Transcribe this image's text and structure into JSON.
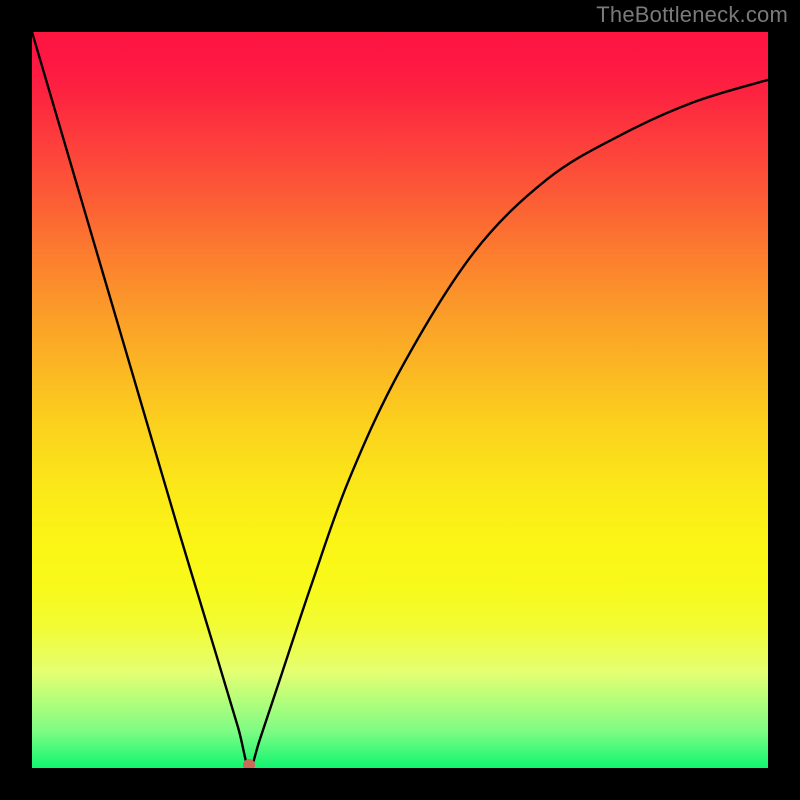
{
  "watermark": "TheBottleneck.com",
  "chart_data": {
    "type": "line",
    "title": "",
    "xlabel": "",
    "ylabel": "",
    "xlim": [
      0,
      1
    ],
    "ylim": [
      0,
      1
    ],
    "note": "Single V-shaped bottleneck curve with a minimum near x≈0.295, y≈0 (marked by a small red dot). Left branch is steep and nearly linear; right branch rises with decreasing slope. Values are normalized fractions of the plot area since no numeric axes are shown.",
    "series": [
      {
        "name": "bottleneck-curve",
        "x": [
          0.0,
          0.05,
          0.1,
          0.15,
          0.2,
          0.25,
          0.28,
          0.295,
          0.31,
          0.34,
          0.38,
          0.43,
          0.5,
          0.6,
          0.7,
          0.8,
          0.9,
          1.0
        ],
        "y": [
          1.0,
          0.83,
          0.66,
          0.49,
          0.32,
          0.155,
          0.055,
          0.0,
          0.04,
          0.13,
          0.25,
          0.39,
          0.54,
          0.7,
          0.8,
          0.86,
          0.905,
          0.935
        ]
      }
    ],
    "marker": {
      "x": 0.295,
      "y": 0.0,
      "color": "#c96b56"
    },
    "background_gradient": {
      "stops": [
        {
          "pos": 0.0,
          "color": "#fe1641"
        },
        {
          "pos": 0.5,
          "color": "#fbc81f"
        },
        {
          "pos": 0.8,
          "color": "#f1fc36"
        },
        {
          "pos": 1.0,
          "color": "#10f570"
        }
      ]
    }
  }
}
